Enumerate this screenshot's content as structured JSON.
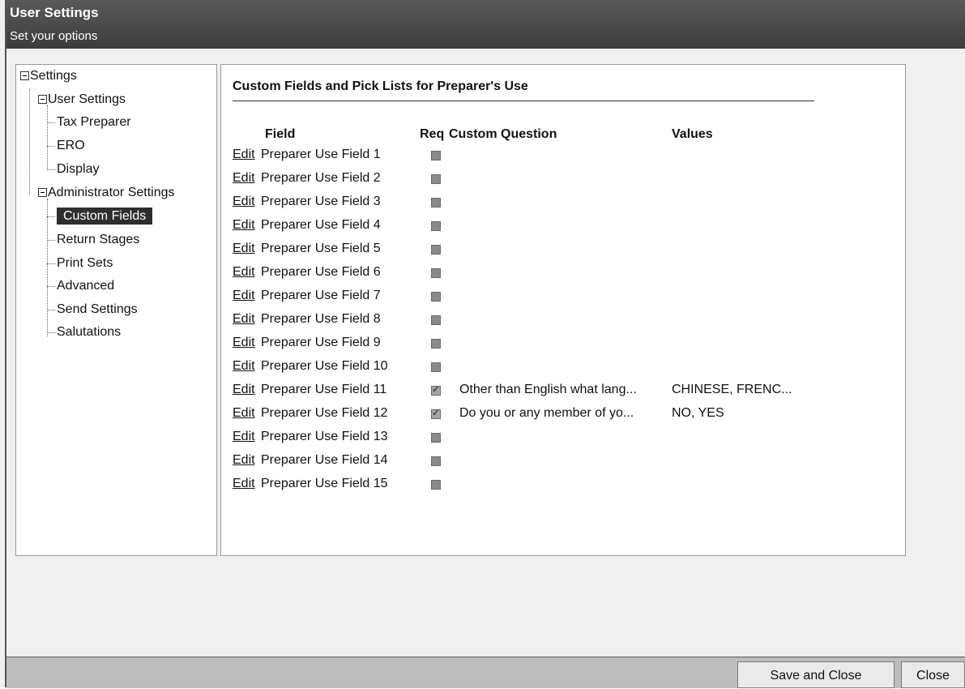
{
  "window": {
    "title": "User Settings",
    "subtitle": "Set your options"
  },
  "tree": {
    "root": "Settings",
    "user_settings": "User Settings",
    "tax_preparer": "Tax Preparer",
    "ero": "ERO",
    "display": "Display",
    "admin_settings": "Administrator Settings",
    "custom_fields": "Custom Fields",
    "return_stages": "Return Stages",
    "print_sets": "Print Sets",
    "advanced": "Advanced",
    "send_settings": "Send Settings",
    "salutations": "Salutations"
  },
  "main": {
    "section_title": "Custom Fields and Pick Lists for Preparer's Use",
    "headers": {
      "field": "Field",
      "req": "Req",
      "custom_question": "Custom Question",
      "values": "Values"
    },
    "edit_label": "Edit",
    "rows": [
      {
        "field": "Preparer Use Field 1",
        "req": false,
        "question": "",
        "values": ""
      },
      {
        "field": "Preparer Use Field 2",
        "req": false,
        "question": "",
        "values": ""
      },
      {
        "field": "Preparer Use Field 3",
        "req": false,
        "question": "",
        "values": ""
      },
      {
        "field": "Preparer Use Field 4",
        "req": false,
        "question": "",
        "values": ""
      },
      {
        "field": "Preparer Use Field 5",
        "req": false,
        "question": "",
        "values": ""
      },
      {
        "field": "Preparer Use Field 6",
        "req": false,
        "question": "",
        "values": ""
      },
      {
        "field": "Preparer Use Field 7",
        "req": false,
        "question": "",
        "values": ""
      },
      {
        "field": "Preparer Use Field 8",
        "req": false,
        "question": "",
        "values": ""
      },
      {
        "field": "Preparer Use Field 9",
        "req": false,
        "question": "",
        "values": ""
      },
      {
        "field": "Preparer Use Field 10",
        "req": false,
        "question": "",
        "values": ""
      },
      {
        "field": "Preparer Use Field 11",
        "req": true,
        "question": "Other than English what lang...",
        "values": "CHINESE, FRENC..."
      },
      {
        "field": "Preparer Use Field 12",
        "req": true,
        "question": "Do you or any member of yo...",
        "values": "NO, YES"
      },
      {
        "field": "Preparer Use Field 13",
        "req": false,
        "question": "",
        "values": ""
      },
      {
        "field": "Preparer Use Field 14",
        "req": false,
        "question": "",
        "values": ""
      },
      {
        "field": "Preparer Use Field 15",
        "req": false,
        "question": "",
        "values": ""
      }
    ]
  },
  "footer": {
    "save_close": "Save and Close",
    "close": "Close"
  }
}
